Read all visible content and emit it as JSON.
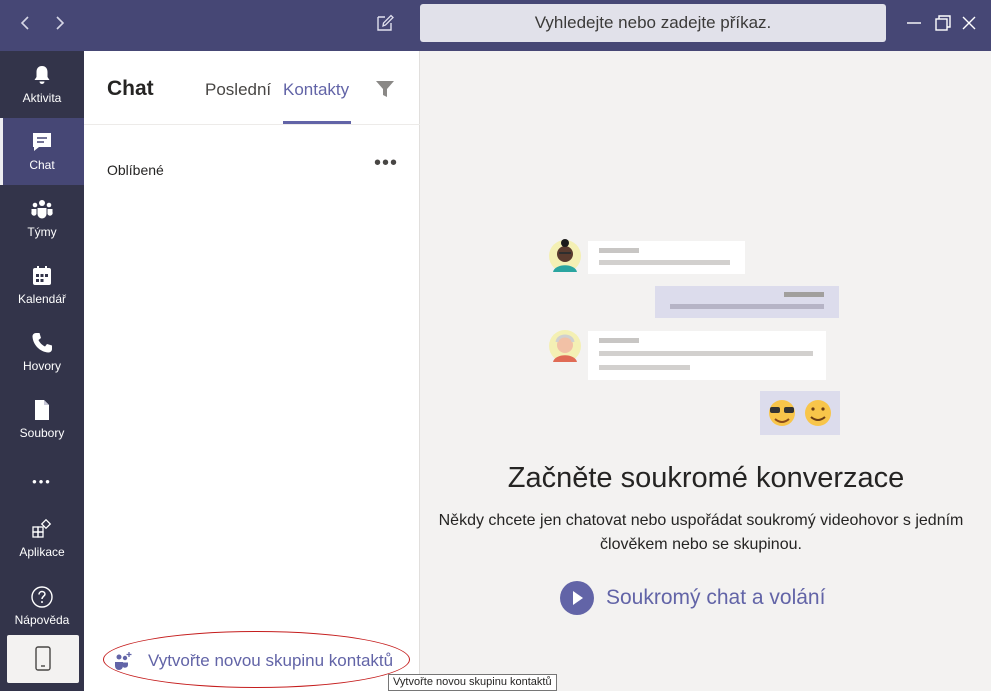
{
  "titlebar": {
    "back_icon": "chevron-left-icon",
    "forward_icon": "chevron-right-icon",
    "compose_icon": "compose-icon",
    "search_placeholder": "Vyhledejte nebo zadejte příkaz.",
    "window_controls": [
      "minimize-icon",
      "maximize-icon",
      "close-icon"
    ]
  },
  "rail": {
    "items": [
      {
        "label": "Aktivita",
        "icon": "bell-icon"
      },
      {
        "label": "Chat",
        "icon": "chat-icon",
        "active": true
      },
      {
        "label": "Týmy",
        "icon": "teams-icon"
      },
      {
        "label": "Kalendář",
        "icon": "calendar-icon"
      },
      {
        "label": "Hovory",
        "icon": "phone-icon"
      },
      {
        "label": "Soubory",
        "icon": "file-icon"
      },
      {
        "label": "Aplikace",
        "icon": "apps-icon"
      },
      {
        "label": "Nápověda",
        "icon": "help-icon"
      }
    ],
    "more_label": "•••",
    "device_icon": "mobile-device-icon"
  },
  "panel": {
    "title": "Chat",
    "tabs": [
      {
        "label": "Poslední",
        "active": false
      },
      {
        "label": "Kontakty",
        "active": true
      }
    ],
    "filter_icon": "filter-icon",
    "section_label": "Oblíbené",
    "more_label": "•••",
    "new_group_label": "Vytvořte novou skupinu kontaktů",
    "tooltip": "Vytvořte novou skupinu kontaktů"
  },
  "main": {
    "headline": "Začněte soukromé konverzace",
    "description": "Někdy chcete jen chatovat nebo uspořádat soukromý videohovor s jedním člověkem nebo se skupinou.",
    "cta_label": "Soukromý chat a volání"
  },
  "colors": {
    "brand": "#6264a7",
    "titlebar": "#464775",
    "rail": "#33344a",
    "highlight": "#c51e1e"
  }
}
